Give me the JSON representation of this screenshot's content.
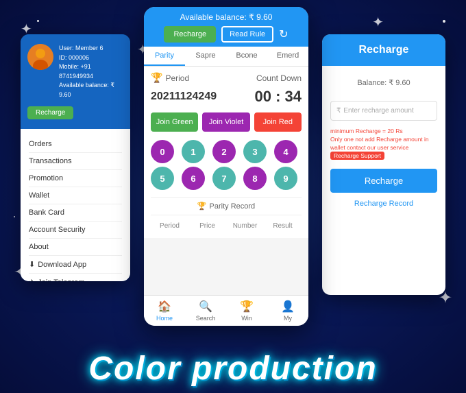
{
  "background": {
    "color": "#0a1a5c"
  },
  "bottom_title": "Color production",
  "left_screen": {
    "user": {
      "label": "User:",
      "name": "Member 6",
      "id_label": "ID:",
      "id": "000006",
      "mobile_label": "Mobile:",
      "mobile": "+91 8741949934",
      "balance_label": "Available balance:",
      "balance": "₹ 9.60",
      "recharge_btn": "Recharge"
    },
    "menu_items": [
      "Orders",
      "Transactions",
      "Promotion",
      "Wallet",
      "Bank Card",
      "Account Security",
      "About",
      "Download App",
      "Join Telegram"
    ]
  },
  "center_screen": {
    "available_balance": "Available balance: ₹ 9.60",
    "btn_recharge": "Recharge",
    "btn_read_rule": "Read Rule",
    "tabs": [
      "Parity",
      "Sapre",
      "Bcone",
      "Emerd"
    ],
    "active_tab": "Parity",
    "period_label": "Period",
    "countdown_label": "Count Down",
    "period_value": "20211124249",
    "countdown_value": "00 : 34",
    "join_green": "Join Green",
    "join_violet": "Join Violet",
    "join_red": "Join Red",
    "numbers": [
      "0",
      "1",
      "2",
      "3",
      "4",
      "5",
      "6",
      "7",
      "8",
      "9"
    ],
    "parity_record_label": "Parity Record",
    "record_headers": [
      "Period",
      "Price",
      "Number",
      "Result"
    ],
    "nav_items": [
      {
        "label": "Home",
        "icon": "🏠"
      },
      {
        "label": "Search",
        "icon": "🔍"
      },
      {
        "label": "Win",
        "icon": "🏆"
      },
      {
        "label": "My",
        "icon": "👤"
      }
    ]
  },
  "right_screen": {
    "title": "Recharge",
    "balance_label": "Balance: ₹ 9.60",
    "input_placeholder": "Enter recharge amount",
    "note1": "minimum Recharge = 20 Rs",
    "note2": "Only one not add Recharge amount in wallet contact our",
    "note3": "user service",
    "recharge_support_label": "Recharge Support",
    "btn_recharge": "Recharge",
    "record_link": "Recharge Record"
  }
}
